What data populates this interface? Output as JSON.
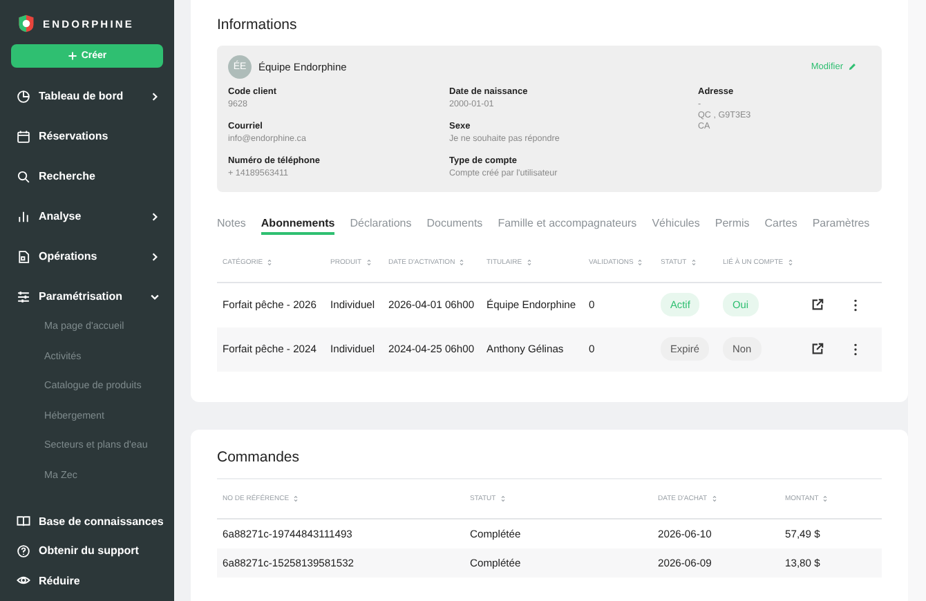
{
  "sidebar": {
    "brand": "ENDORPHINE",
    "create_button": "Créer",
    "items": [
      {
        "label": "Tableau de bord",
        "kind": "group",
        "expanded": false
      },
      {
        "label": "Réservations",
        "kind": "link",
        "expanded": false
      },
      {
        "label": "Recherche",
        "kind": "link",
        "expanded": false
      },
      {
        "label": "Analyse",
        "kind": "group",
        "expanded": false
      },
      {
        "label": "Opérations",
        "kind": "group",
        "expanded": false
      },
      {
        "label": "Paramétrisation",
        "kind": "group",
        "expanded": true,
        "children": [
          {
            "label": "Ma page d'accueil"
          },
          {
            "label": "Activités"
          },
          {
            "label": "Catalogue de produits"
          },
          {
            "label": "Hébergement"
          },
          {
            "label": "Secteurs et plans d'eau"
          },
          {
            "label": "Ma Zec"
          }
        ]
      }
    ],
    "footer_items": [
      {
        "label": "Base de connaissances"
      },
      {
        "label": "Obtenir du support"
      },
      {
        "label": "Réduire"
      }
    ]
  },
  "informations": {
    "title": "Informations",
    "avatar": "ÉE",
    "name": "Équipe Endorphine",
    "edit_link": "Modifier",
    "fields": [
      {
        "label": "Code client",
        "lines": [
          "9628"
        ]
      },
      {
        "label": "Date de naissance",
        "lines": [
          "2000-01-01"
        ]
      },
      {
        "label": "Adresse",
        "lines": [
          "-",
          "QC , G9T3E3",
          "CA"
        ]
      },
      {
        "label": "Courriel",
        "lines": [
          "info@endorphine.ca"
        ]
      },
      {
        "label": "Sexe",
        "lines": [
          "Je ne souhaite pas répondre"
        ]
      },
      {
        "label": "Numéro de téléphone",
        "lines": [
          "+ 14189563411"
        ]
      },
      {
        "label": "Type de compte",
        "lines": [
          "Compte créé par l'utilisateur"
        ]
      }
    ]
  },
  "tabs": [
    {
      "label": "Notes",
      "selected": false
    },
    {
      "label": "Abonnements",
      "selected": true
    },
    {
      "label": "Déclarations",
      "selected": false
    },
    {
      "label": "Documents",
      "selected": false
    },
    {
      "label": "Famille et accompagnateurs",
      "selected": false
    },
    {
      "label": "Véhicules",
      "selected": false
    },
    {
      "label": "Permis",
      "selected": false
    },
    {
      "label": "Cartes",
      "selected": false
    },
    {
      "label": "Paramètres",
      "selected": false
    }
  ],
  "subscriptions": {
    "columns": [
      "CATÉGORIE",
      "PRODUIT",
      "DATE D'ACTIVATION",
      "TITULAIRE",
      "VALIDATIONS",
      "STATUT",
      "LIÉ À UN COMPTE"
    ],
    "rows": [
      {
        "category": "Forfait pêche - 2026",
        "product": "Individuel",
        "activation": "2026-04-01 06h00",
        "holder": "Équipe Endorphine",
        "validations": "0",
        "status": {
          "label": "Actif",
          "active": true
        },
        "linked": {
          "label": "Oui",
          "active": true
        }
      },
      {
        "category": "Forfait pêche - 2024",
        "product": "Individuel",
        "activation": "2024-04-25 06h00",
        "holder": "Anthony Gélinas",
        "validations": "0",
        "status": {
          "label": "Expiré",
          "active": false
        },
        "linked": {
          "label": "Non",
          "active": false
        }
      }
    ]
  },
  "orders": {
    "title": "Commandes",
    "columns": [
      "NO DE RÉFÉRENCE",
      "STATUT",
      "DATE D'ACHAT",
      "MONTANT"
    ],
    "rows": [
      [
        "6a88271c-19744843111493",
        "Complétée",
        "2026-06-10",
        "57,49 $"
      ],
      [
        "6a88271c-15258139581532",
        "Complétée",
        "2026-06-09",
        "13,80 $"
      ]
    ]
  }
}
